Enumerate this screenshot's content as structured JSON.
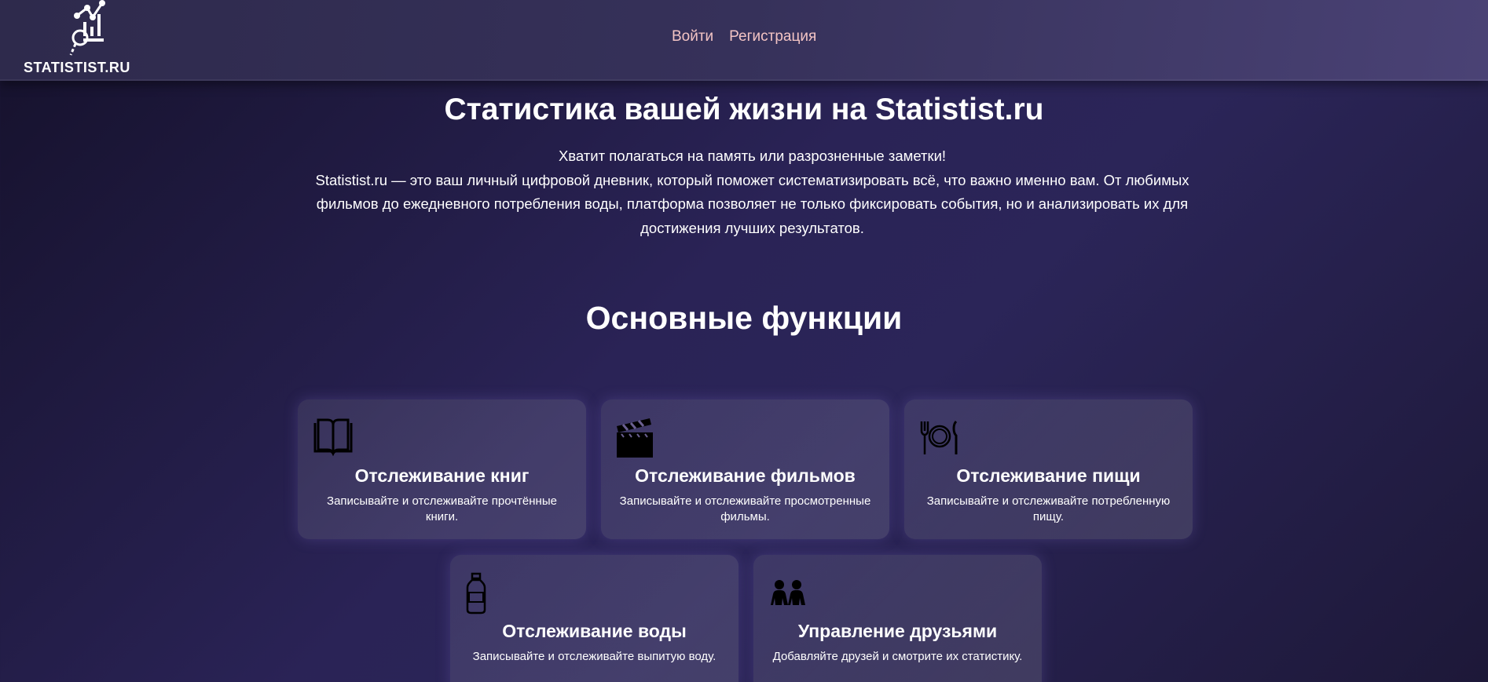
{
  "header": {
    "logo_text": "STATISTIST.RU",
    "nav": [
      {
        "label": "Войти"
      },
      {
        "label": "Регистрация"
      }
    ]
  },
  "hero": {
    "title": "Статистика вашей жизни на Statistist.ru",
    "lines": [
      "Хватит полагаться на память или разрозненные заметки!",
      "Statistist.ru — это ваш личный цифровой дневник, который поможет систематизировать всё, что важно именно вам. От любимых фильмов до ежедневного потребления воды, платформа позволяет не только фиксировать события, но и анализировать их для достижения лучших результатов."
    ]
  },
  "features": {
    "title": "Основные функции",
    "cards": [
      {
        "icon": "book-icon",
        "title": "Отслеживание книг",
        "desc": "Записывайте и отслеживайте прочтённые книги."
      },
      {
        "icon": "clapperboard-icon",
        "title": "Отслеживание фильмов",
        "desc": "Записывайте и отслеживайте просмотренные фильмы."
      },
      {
        "icon": "plate-cutlery-icon",
        "title": "Отслеживание пищи",
        "desc": "Записывайте и отслеживайте потребленную пищу."
      },
      {
        "icon": "water-bottle-icon",
        "title": "Отслеживание воды",
        "desc": "Записывайте и отслеживайте выпитую воду."
      },
      {
        "icon": "friends-icon",
        "title": "Управление друзьями",
        "desc": "Добавляйте друзей и смотрите их статистику."
      }
    ]
  }
}
